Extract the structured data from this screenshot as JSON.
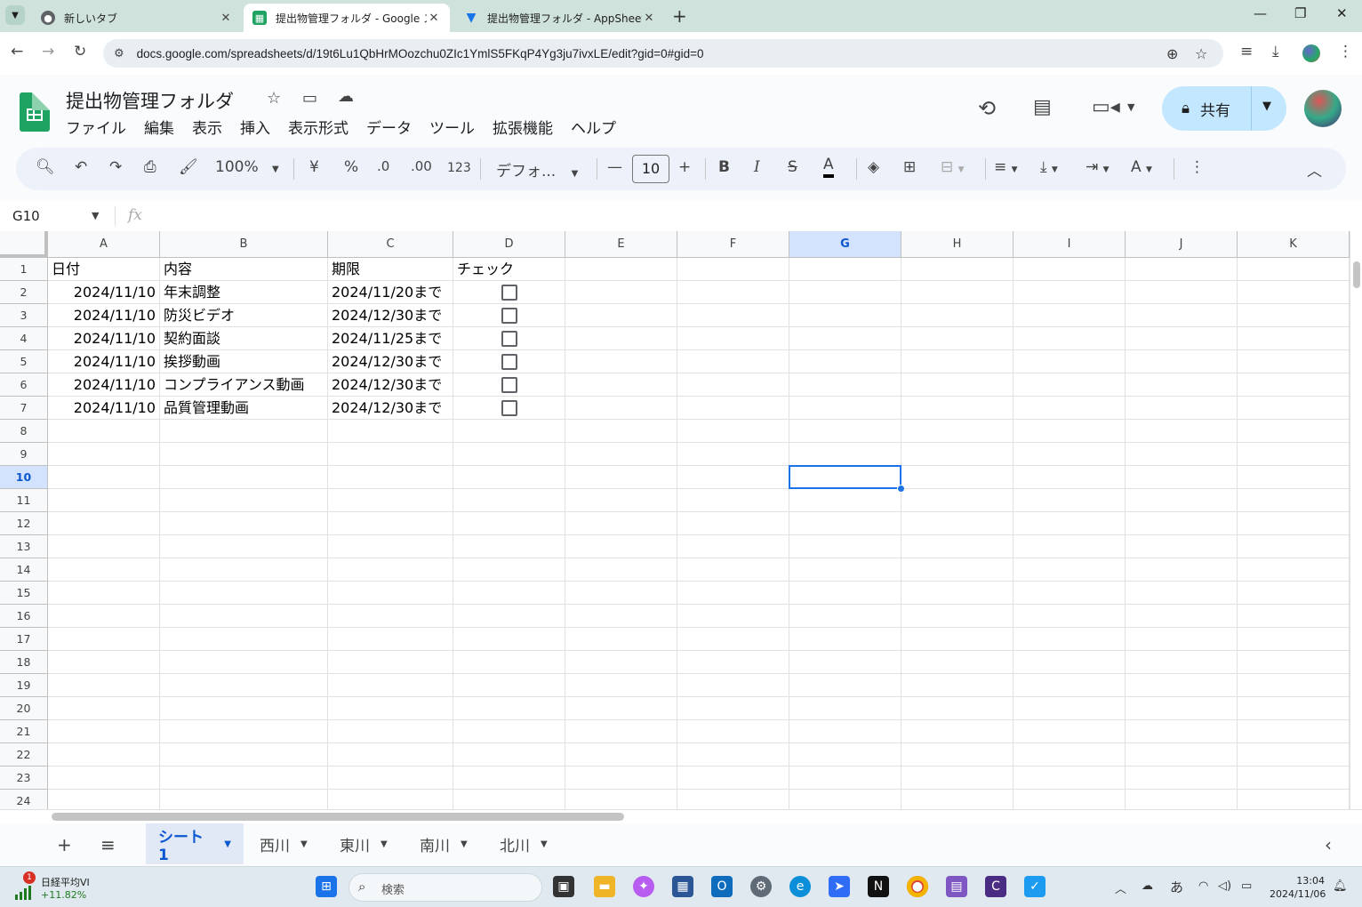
{
  "browser": {
    "tabs": [
      {
        "title": "新しいタブ",
        "icon": "chrome-icon",
        "active": false
      },
      {
        "title": "提出物管理フォルダ - Google スプ",
        "icon": "sheets-icon",
        "active": true
      },
      {
        "title": "提出物管理フォルダ - AppSheet",
        "icon": "appsheet-icon",
        "active": false
      }
    ],
    "url": "docs.google.com/spreadsheets/d/19t6Lu1QbHrMOozchu0ZIc1YmlS5FKqP4Yg3ju7ivxLE/edit?gid=0#gid=0"
  },
  "doc": {
    "title": "提出物管理フォルダ",
    "menu": [
      "ファイル",
      "編集",
      "表示",
      "挿入",
      "表示形式",
      "データ",
      "ツール",
      "拡張機能",
      "ヘルプ"
    ],
    "share_label": "共有"
  },
  "toolbar": {
    "zoom": "100%",
    "currency": "¥",
    "percent": "%",
    "dec_decrease": ".0",
    "dec_increase": ".00",
    "format_123": "123",
    "font": "デフォ...",
    "font_size": "10"
  },
  "formula_bar": {
    "cell_ref": "G10",
    "fx": "fx",
    "value": ""
  },
  "sheet": {
    "columns": [
      "A",
      "B",
      "C",
      "D",
      "E",
      "F",
      "G",
      "H",
      "I",
      "J",
      "K"
    ],
    "selected_column": "G",
    "selected_row": 10,
    "row_numbers": [
      "1",
      "2",
      "3",
      "4",
      "5",
      "6",
      "7",
      "8",
      "9",
      "10",
      "11",
      "12",
      "13",
      "14",
      "15",
      "16",
      "17",
      "18",
      "19",
      "20",
      "21",
      "22",
      "23",
      "24"
    ],
    "headers": {
      "a": "日付",
      "b": "内容",
      "c": "期限",
      "d": "チェック"
    },
    "rows": [
      {
        "date": "2024/11/10",
        "content": "年末調整",
        "deadline": "2024/11/20まで",
        "checked": false
      },
      {
        "date": "2024/11/10",
        "content": "防災ビデオ",
        "deadline": "2024/12/30まで",
        "checked": false
      },
      {
        "date": "2024/11/10",
        "content": "契約面談",
        "deadline": "2024/11/25まで",
        "checked": false
      },
      {
        "date": "2024/11/10",
        "content": "挨拶動画",
        "deadline": "2024/12/30まで",
        "checked": false
      },
      {
        "date": "2024/11/10",
        "content": "コンプライアンス動画",
        "deadline": "2024/12/30まで",
        "checked": false
      },
      {
        "date": "2024/11/10",
        "content": "品質管理動画",
        "deadline": "2024/12/30まで",
        "checked": false
      }
    ]
  },
  "sheet_tabs": [
    "シート1",
    "西川",
    "東川",
    "南川",
    "北川"
  ],
  "active_sheet": "シート1",
  "taskbar": {
    "widget_title": "日経平均VI",
    "widget_value": "+11.82%",
    "widget_badge": "1",
    "search_placeholder": "検索",
    "ime": "あ",
    "time": "13:04",
    "date": "2024/11/06"
  }
}
